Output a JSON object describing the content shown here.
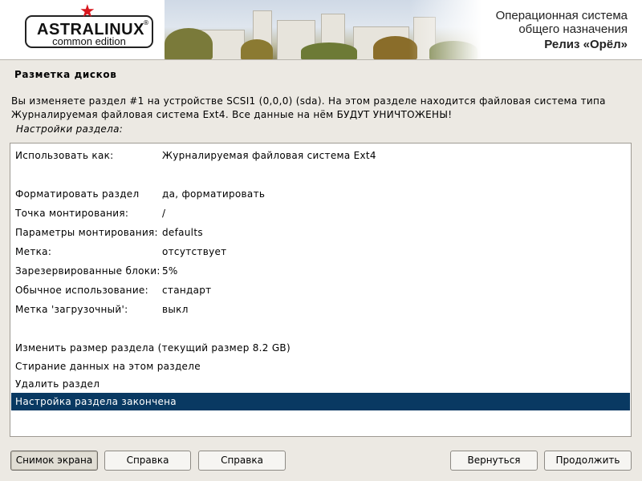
{
  "banner": {
    "brand": "ASTRALINUX",
    "registered": "®",
    "edition": "common edition",
    "os_line1": "Операционная система",
    "os_line2": "общего назначения",
    "release": "Релиз «Орёл»",
    "accent_color": "#d8161d"
  },
  "page": {
    "title": "Разметка дисков",
    "description_line1": "Вы изменяете раздел #1 на устройстве SCSI1 (0,0,0) (sda). На этом разделе находится файловая система типа",
    "description_line2": "Журналируемая файловая система Ext4. Все данные на нём БУДУТ УНИЧТОЖЕНЫ!",
    "settings_label": "Настройки раздела:"
  },
  "list": {
    "selected_color": "#093962",
    "items": [
      {
        "label": "Использовать как:",
        "value": "Журналируемая файловая система Ext4"
      },
      {
        "label": "Форматировать раздел",
        "value": "да, форматировать"
      },
      {
        "label": "Точка монтирования:",
        "value": "/"
      },
      {
        "label": "Параметры монтирования:",
        "value": "defaults"
      },
      {
        "label": "Метка:",
        "value": "отсутствует"
      },
      {
        "label": "Зарезервированные блоки:",
        "value": "5%"
      },
      {
        "label": "Обычное использование:",
        "value": "стандарт"
      },
      {
        "label": "Метка 'загрузочный':",
        "value": "выкл"
      },
      {
        "label": "Изменить размер раздела (текущий размер 8.2 GB)",
        "value": ""
      },
      {
        "label": "Стирание данных на этом разделе",
        "value": ""
      },
      {
        "label": "Удалить раздел",
        "value": ""
      },
      {
        "label": "Настройка раздела закончена",
        "value": "",
        "selected": true
      }
    ]
  },
  "buttons": {
    "screenshot": "Снимок экрана",
    "help1": "Справка",
    "help2": "Справка",
    "back": "Вернуться",
    "continue": "Продолжить"
  }
}
